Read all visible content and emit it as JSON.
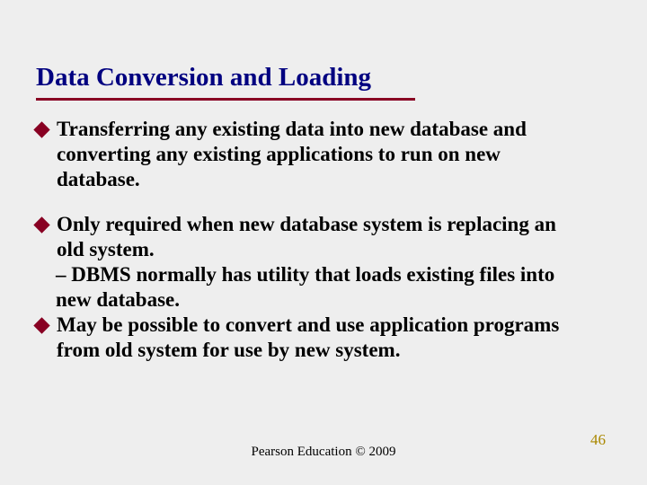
{
  "title": "Data Conversion and Loading",
  "bullets": {
    "b0": "Transferring any existing data into new database and converting any existing applications to run on new database.",
    "b1": "Only required when new database system is replacing an old system.",
    "b1_sub": "– DBMS normally has utility that loads existing files into new database.",
    "b2": "May be possible to convert and use application programs from old system for use by new system."
  },
  "footer": "Pearson Education © 2009",
  "page": "46"
}
